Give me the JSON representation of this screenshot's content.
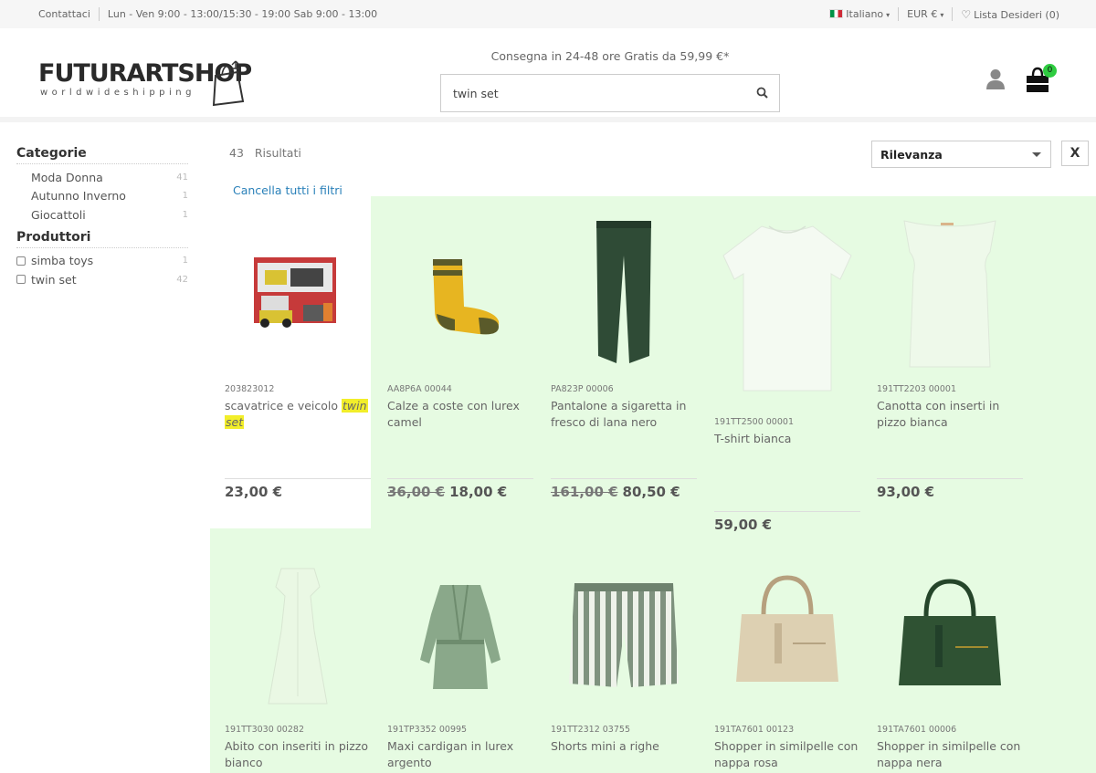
{
  "topbar": {
    "contact": "Contattaci",
    "hours": "Lun - Ven 9:00 - 13:00/15:30 - 19:00 Sab 9:00 - 13:00",
    "language": "Italiano",
    "currency": "EUR €",
    "wishlist": "Lista Desideri (0)"
  },
  "header": {
    "logo_main": "FUTURART",
    "logo_shop": "SHOP",
    "logo_sub": "worldwideshipping",
    "delivery": "Consegna in 24-48 ore Gratis da 59,99 €*",
    "search_value": "twin set",
    "cart_count": "0"
  },
  "sidebar": {
    "categories_title": "Categorie",
    "categories": [
      {
        "label": "Moda Donna",
        "count": "41"
      },
      {
        "label": "Autunno Inverno",
        "count": "1"
      },
      {
        "label": "Giocattoli",
        "count": "1"
      }
    ],
    "producers_title": "Produttori",
    "producers": [
      {
        "label": "simba toys",
        "count": "1"
      },
      {
        "label": "twin set",
        "count": "42"
      }
    ]
  },
  "results": {
    "count": "43",
    "label": "Risultati",
    "clear": "Cancella tutti i filtri",
    "sort": "Rilevanza",
    "close": "X"
  },
  "products": [
    {
      "sku": "203823012",
      "name_pre": "scavatrice e veicolo ",
      "name_hl1": "twin",
      "name_hl2": "set",
      "old": "",
      "price": "23,00 €"
    },
    {
      "sku": "AA8P6A 00044",
      "name": "Calze a coste con lurex camel",
      "old": "36,00 €",
      "price": "18,00 €"
    },
    {
      "sku": "PA823P 00006",
      "name": "Pantalone a sigaretta in fresco di lana nero",
      "old": "161,00 €",
      "price": "80,50 €"
    },
    {
      "sku": "191TT2500 00001",
      "name": "T-shirt bianca",
      "old": "",
      "price": "59,00 €"
    },
    {
      "sku": "191TT2203 00001",
      "name": "Canotta con inserti in pizzo bianca",
      "old": "",
      "price": "93,00 €"
    },
    {
      "sku": "191TT3030 00282",
      "name": "Abito con inseriti in pizzo bianco",
      "old": "",
      "price": ""
    },
    {
      "sku": "191TP3352 00995",
      "name": "Maxi cardigan in lurex argento",
      "old": "",
      "price": ""
    },
    {
      "sku": "191TT2312 03755",
      "name": "Shorts mini a righe",
      "old": "",
      "price": ""
    },
    {
      "sku": "191TA7601 00123",
      "name": "Shopper in similpelle con nappa rosa",
      "old": "",
      "price": ""
    },
    {
      "sku": "191TA7601 00006",
      "name": "Shopper in similpelle con nappa nera",
      "old": "",
      "price": ""
    }
  ],
  "colors": {
    "highlight_bg": "#e6fbe2",
    "link": "#2980b9",
    "badge": "#2ecc40",
    "search_highlight": "#f2ee2a"
  }
}
